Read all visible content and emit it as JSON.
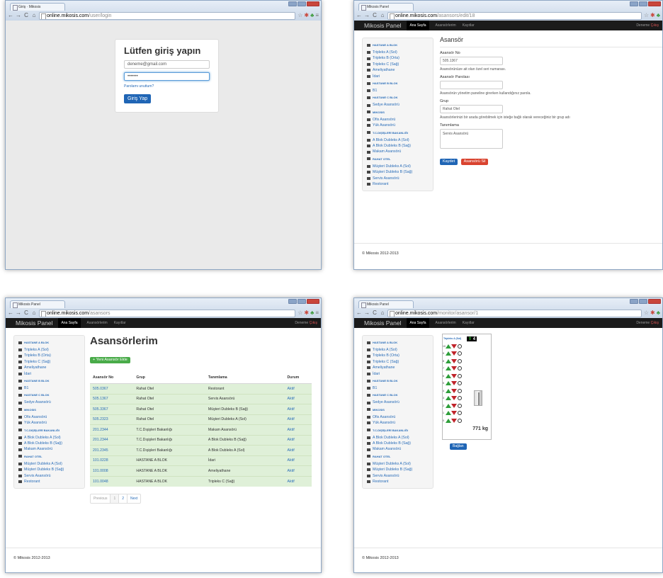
{
  "w1": {
    "tab": "Giriş · Mikosis",
    "url_host": "online.mikosis.com",
    "url_path": "/user/login",
    "login": {
      "title": "Lütfen giriş yapın",
      "email": "deneme@gmail.com",
      "password": "•••••••",
      "forgot": "Parolamı unuttum?",
      "submit": "Giriş Yap"
    }
  },
  "nav": {
    "brand": "Mikosis Panel",
    "home": "Ana Sayfa",
    "elevators": "Asansörlerim",
    "logs": "Kayıtlar",
    "user": "Deneme",
    "logout": "Çıkış"
  },
  "w2": {
    "tab": "Mikosis Panel",
    "url_host": "online.mikosis.com",
    "url_path": "/asansors/edit/18",
    "form": {
      "heading": "Asansör",
      "f1_label": "Asansör No",
      "f1_value": "505.1367",
      "f1_hint": "Asansörünüze ait olan özel seri numarası.",
      "f2_label": "Asansör Parolası",
      "f2_value": "",
      "f2_hint": "Asansörün yönetim paneline girerken kullandığınız parola.",
      "f3_label": "Grup",
      "f3_value": "Rahat Otel",
      "f3_hint": "Asansörlerinizi bir arada görebilmek için isteğe bağlı olarak vereceğiniz bir grup adı",
      "f4_label": "Tanımlama",
      "f4_value": "Servis Asansörü",
      "save": "Kaydet",
      "delete": "Asansörü Sil"
    }
  },
  "w3": {
    "tab": "Mikosis Panel",
    "url_host": "online.mikosis.com",
    "url_path": "/asansors",
    "title": "Asansörlerim",
    "new_btn": "+ Yeni Asansör Ekle",
    "headers": [
      "Asansör No",
      "Grup",
      "Tanımlama",
      "Durum"
    ],
    "rows": [
      [
        "505.0367",
        "Rahat Otel",
        "Restorant",
        "Aktif"
      ],
      [
        "505.1367",
        "Rahat Otel",
        "Servis Asansörü",
        "Aktif"
      ],
      [
        "505.3367",
        "Rahat Otel",
        "Müşteri Dubleks B (Sağ)",
        "Aktif"
      ],
      [
        "505.2323",
        "Rahat Otel",
        "Müşteri Dubleks A (Sol)",
        "Aktif"
      ],
      [
        "201.2344",
        "T.C.Dışişleri Bakanlığı",
        "Makam Asansörü",
        "Aktif"
      ],
      [
        "201.2344",
        "T.C.Dışişleri Bakanlığı",
        "A Blok Dubleks B (Sağ)",
        "Aktif"
      ],
      [
        "201.2345",
        "T.C.Dışişleri Bakanlığı",
        "A Blok Dubleks A (Sol)",
        "Aktif"
      ],
      [
        "101.0228",
        "HASTANE A BLOK",
        "İdari",
        "Aktif"
      ],
      [
        "101.0008",
        "HASTANE A BLOK",
        "Ameliyathane",
        "Aktif"
      ],
      [
        "101.0048",
        "HASTANE A BLOK",
        "Tripleks C (Sağ)",
        "Aktif"
      ]
    ],
    "pager": {
      "prev": "Previous",
      "p1": "1",
      "p2": "2",
      "next": "Next"
    }
  },
  "w4": {
    "tab": "Mikosis Panel",
    "url_host": "online.mikosis.com",
    "url_path": "/monitor/asansor/1",
    "monitor_title": "Tripleks A (Sol)",
    "floor": "4",
    "load": "771 kg",
    "connect": "Bağlan",
    "floor_nums": [
      "10",
      "9",
      "8",
      "7",
      "6",
      "5",
      "4",
      "3",
      "2",
      "1",
      "0"
    ]
  },
  "sidebar": {
    "g1": "HASTANE A BLOK",
    "g1_items": [
      "Tripleks A (Sol)",
      "Tripleks B (Orta)",
      "Tripleks C (Sağ)",
      "Ameliyathane",
      "İdari"
    ],
    "g2": "HASTANE B BLOK",
    "g2_items": [
      "B1"
    ],
    "g3": "HASTANE C BLOK",
    "g3_items": [
      "Sedye Asansörü"
    ],
    "g4": "MIKOSIS",
    "g4_items": [
      "Ofis Asansörü",
      "Yük Asansörü"
    ],
    "g5": "T.C.DIŞİŞLERİ BAKANLIĞI",
    "g5_items": [
      "A Blok Dubleks A (Sol)",
      "A Blok Dubleks B (Sağ)",
      "Makam Asansörü"
    ],
    "g6": "RAHAT OTEL",
    "g6_items": [
      "Müşteri Dubleks A (Sol)",
      "Müşteri Dubleks B (Sağ)",
      "Servis Asansörü",
      "Restorant"
    ]
  },
  "footer": "© Mikosis 2012-2013"
}
